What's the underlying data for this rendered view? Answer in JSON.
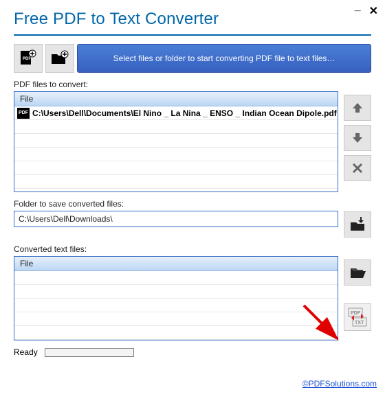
{
  "window": {
    "title": "Free PDF to Text Converter"
  },
  "toolbar": {
    "select_button_label": "Select files or folder to start converting PDF file to text files…"
  },
  "pdf_files": {
    "label": "PDF files to convert:",
    "column_header": "File",
    "items": [
      "C:\\Users\\Dell\\Documents\\El Nino _ La Nina _ ENSO _ Indian Ocean Dipole.pdf"
    ]
  },
  "save_folder": {
    "label": "Folder to save converted files:",
    "value": "C:\\Users\\Dell\\Downloads\\"
  },
  "converted_files": {
    "label": "Converted text files:",
    "column_header": "File",
    "items": []
  },
  "status": {
    "text": "Ready"
  },
  "footer": {
    "link_text": "©PDFSolutions.com"
  }
}
